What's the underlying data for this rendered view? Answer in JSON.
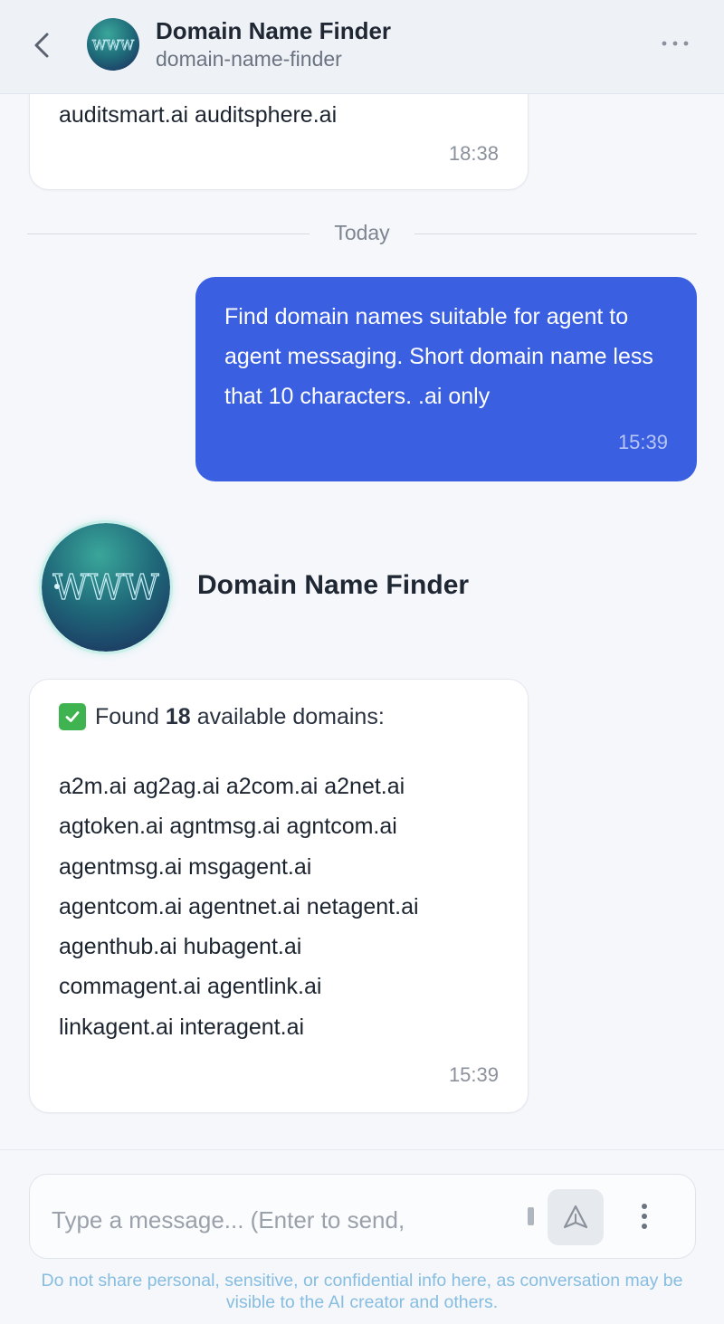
{
  "header": {
    "title": "Domain Name Finder",
    "subtitle": "domain-name-finder",
    "back_icon": "chevron-left-icon",
    "more_icon": "more-horizontal-icon"
  },
  "previous_message": {
    "text": "auditsmart.ai auditsphere.ai",
    "time": "18:38"
  },
  "divider": {
    "label": "Today"
  },
  "user_message": {
    "text": "Find domain names suitable for agent to agent messaging. Short domain name less that 10 characters. .ai only",
    "time": "15:39"
  },
  "bot": {
    "name": "Domain Name Finder",
    "avatar_text": "WWW"
  },
  "bot_reply": {
    "found_prefix": "Found",
    "found_count": "18",
    "found_suffix": "available domains:",
    "domain_lines": [
      "a2m.ai ag2ag.ai a2com.ai a2net.ai",
      "agtoken.ai agntmsg.ai agntcom.ai",
      "agentmsg.ai msgagent.ai",
      "agentcom.ai agentnet.ai netagent.ai",
      "agenthub.ai hubagent.ai",
      "commagent.ai agentlink.ai",
      "linkagent.ai interagent.ai"
    ],
    "time": "15:39"
  },
  "composer": {
    "placeholder": "Type a message... (Enter to send,",
    "send_icon": "send-icon",
    "options_icon": "more-vertical-icon"
  },
  "disclaimer": "Do not share personal, sensitive, or confidential info here, as conversation may be visible to the AI creator and others.",
  "colors": {
    "user_bubble": "#3a5fe0",
    "header_bg": "#eef2f7",
    "page_bg": "#f5f7fb",
    "disclaimer": "#86bde0",
    "check": "#3fb34f"
  }
}
